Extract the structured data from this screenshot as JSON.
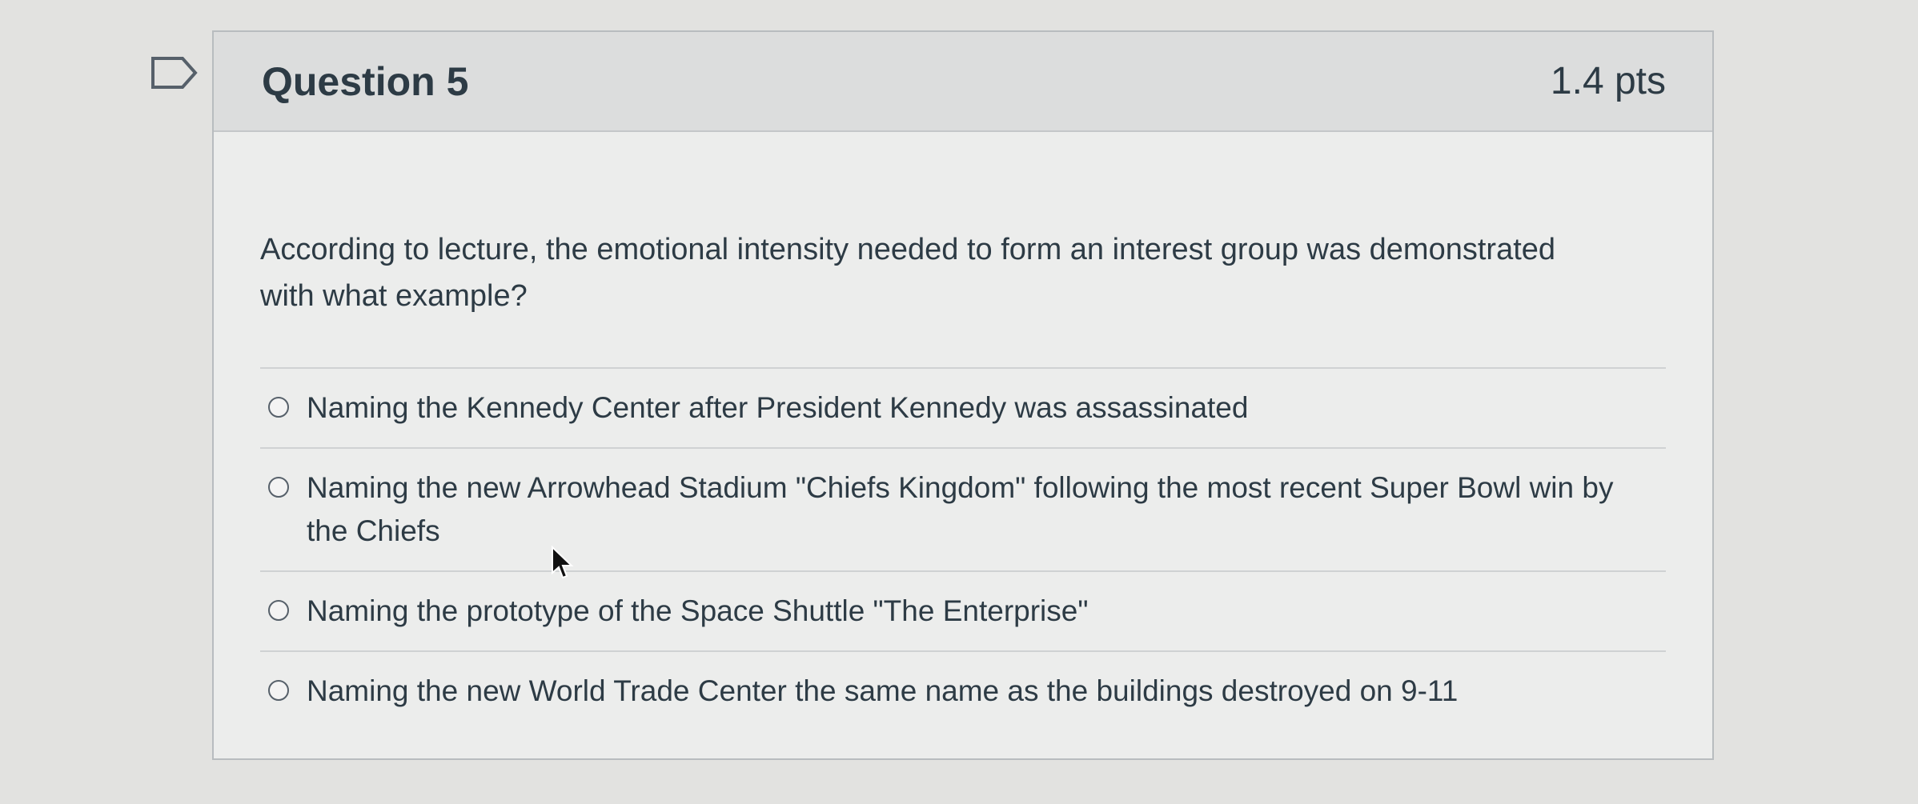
{
  "question": {
    "title": "Question 5",
    "points": "1.4 pts",
    "text": "According to lecture, the emotional intensity needed to form an interest group was demonstrated with what example?",
    "answers": [
      {
        "label": "Naming the Kennedy Center after President Kennedy was assassinated",
        "selected": false
      },
      {
        "label": "Naming the new Arrowhead Stadium \"Chiefs Kingdom\" following the most recent Super Bowl win by the Chiefs",
        "selected": false
      },
      {
        "label": "Naming the prototype of the Space Shuttle \"The Enterprise\"",
        "selected": false
      },
      {
        "label": "Naming the new World Trade Center the same name as the buildings destroyed on 9-11",
        "selected": false
      }
    ]
  },
  "icons": {
    "flag": "flag-question-icon",
    "cursor": "mouse-pointer-icon",
    "radio": "radio-button-icon"
  },
  "colors": {
    "background": "#e2e2e0",
    "header": "#dcdddd",
    "card": "#ecedec",
    "text": "#2d3b45",
    "border": "#b8bcbf"
  }
}
